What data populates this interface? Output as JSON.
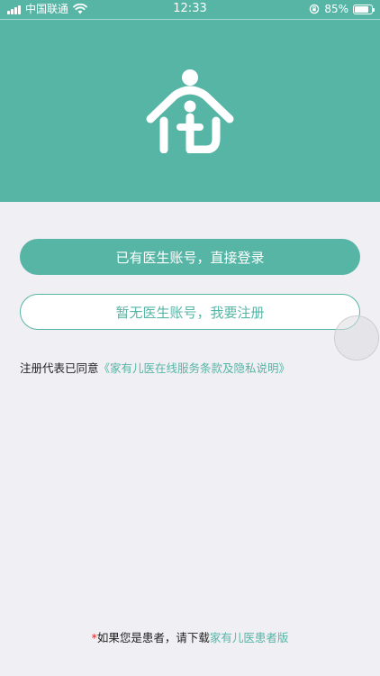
{
  "status_bar": {
    "carrier": "中国联通",
    "time": "12:33",
    "battery_percent": "85%",
    "battery_level": 0.85
  },
  "logo": {
    "icon": "family-house-icon"
  },
  "buttons": {
    "login_label": "已有医生账号，直接登录",
    "register_label": "暂无医生账号，我要注册"
  },
  "agreement": {
    "prefix": "注册代表已同意",
    "link": "《家有儿医在线服务条款及隐私说明》"
  },
  "footer": {
    "star": "*",
    "text": "如果您是患者，请下载",
    "link": "家有儿医患者版"
  },
  "colors": {
    "brand": "#57b5a6",
    "background": "#f0eff4",
    "accent_red": "#e02020"
  }
}
